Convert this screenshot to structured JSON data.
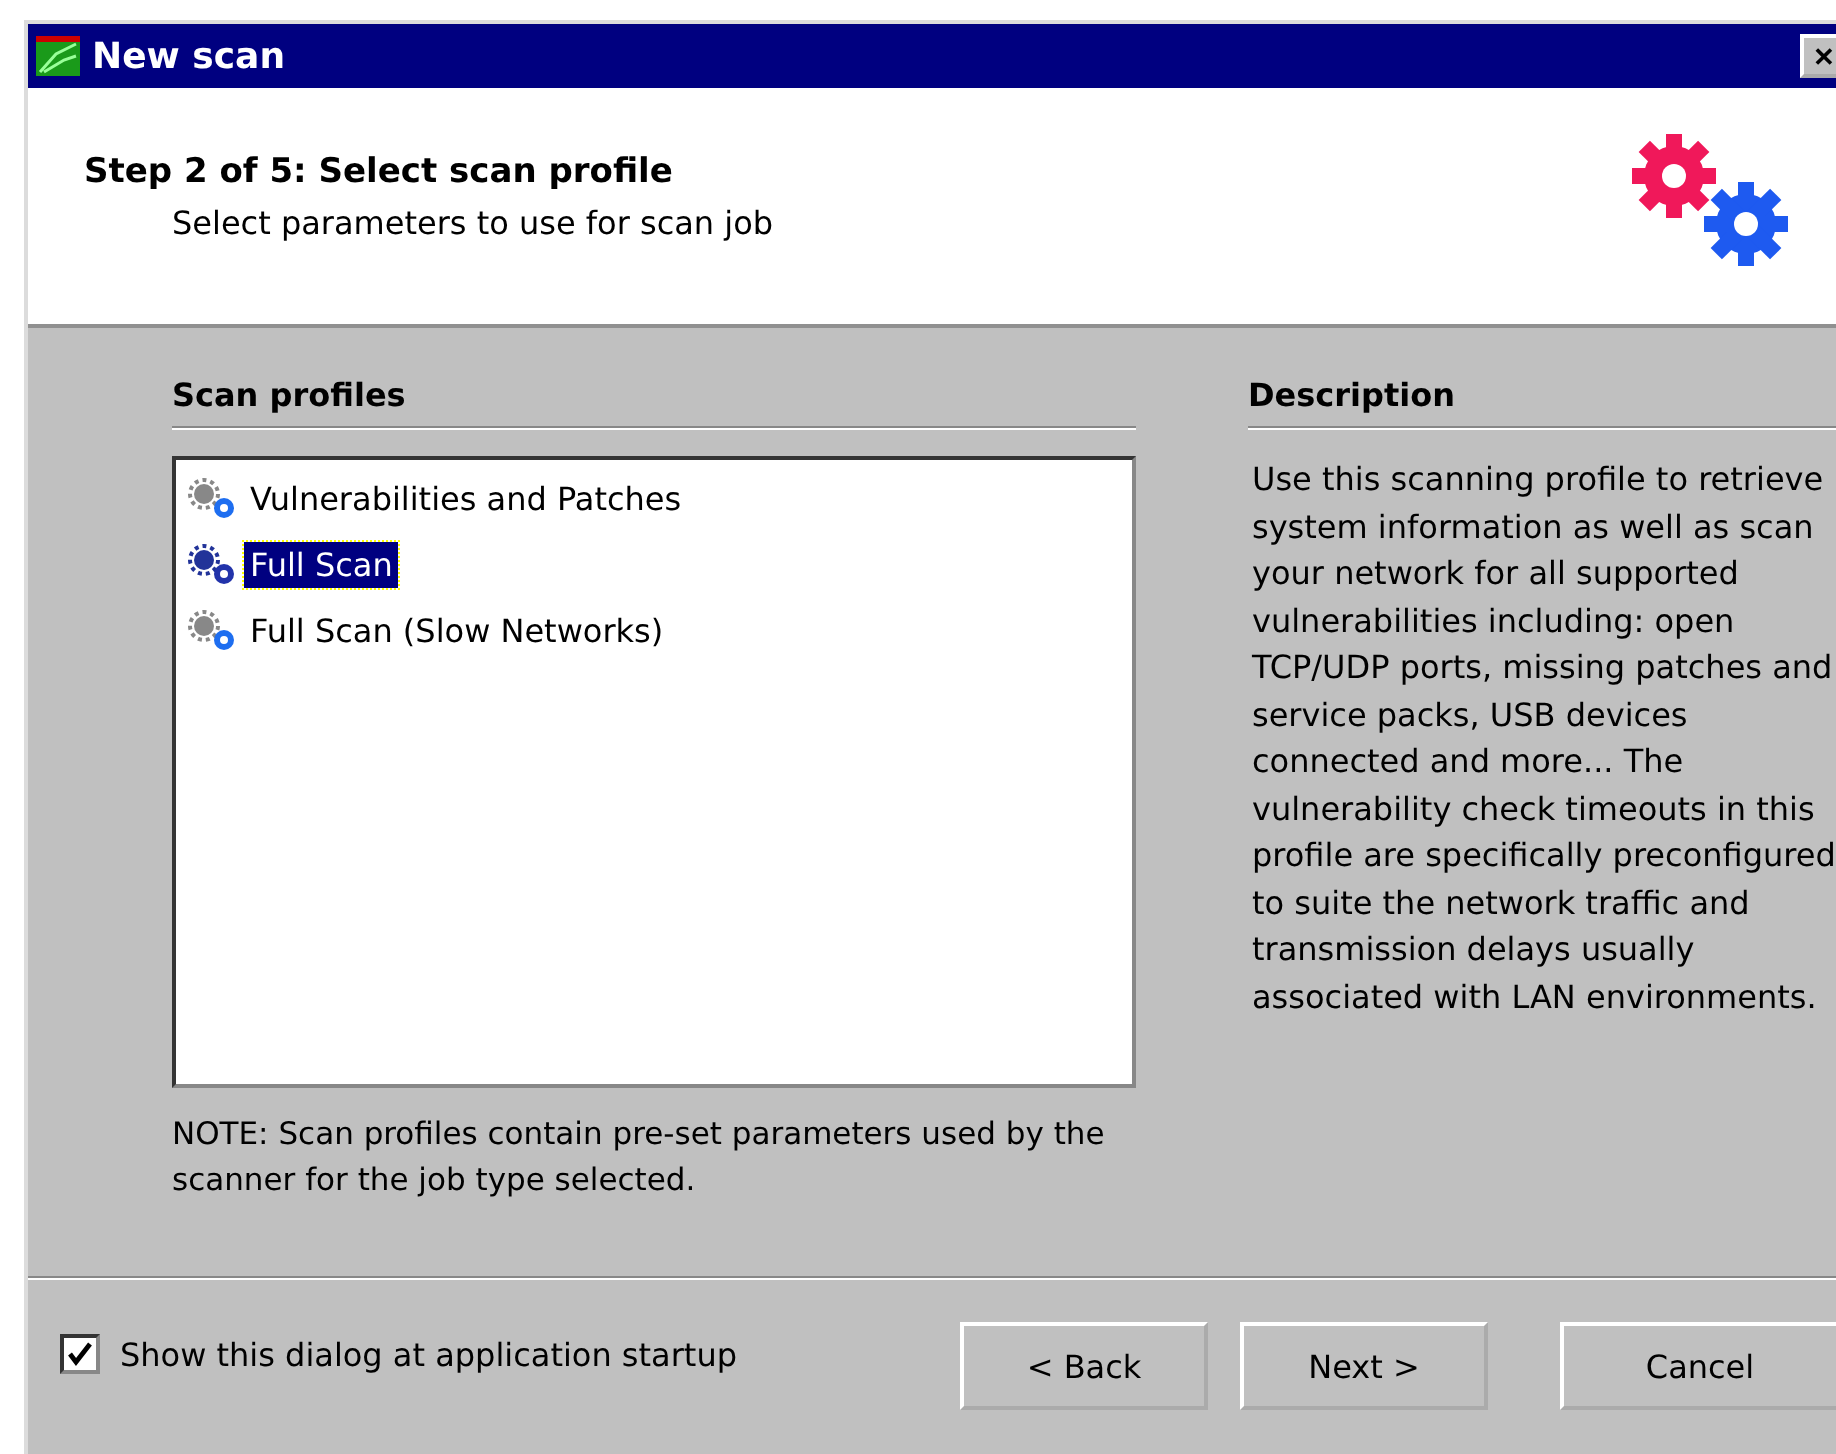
{
  "window": {
    "title": "New scan",
    "close": "✕"
  },
  "header": {
    "title": "Step 2 of 5: Select scan profile",
    "subtitle": "Select parameters to use for scan job"
  },
  "profiles": {
    "heading": "Scan profiles",
    "items": [
      {
        "label": "Vulnerabilities and Patches",
        "selected": false
      },
      {
        "label": "Full Scan",
        "selected": true
      },
      {
        "label": "Full Scan (Slow Networks)",
        "selected": false
      }
    ],
    "note": "NOTE: Scan profiles contain pre-set parameters used by the scanner for the job type selected."
  },
  "description": {
    "heading": "Description",
    "text": "Use this scanning profile to retrieve system information as well as scan your network for all supported vulnerabilities including: open TCP/UDP ports, missing patches and service packs, USB devices connected and more... The vulnerability check timeouts in this profile are specifically preconfigured to suite the network traffic and transmission delays usually associated with LAN environments."
  },
  "startup_checkbox": {
    "label": "Show this dialog at application startup",
    "checked": true
  },
  "buttons": [
    "< Back",
    "Next >",
    "Cancel"
  ]
}
